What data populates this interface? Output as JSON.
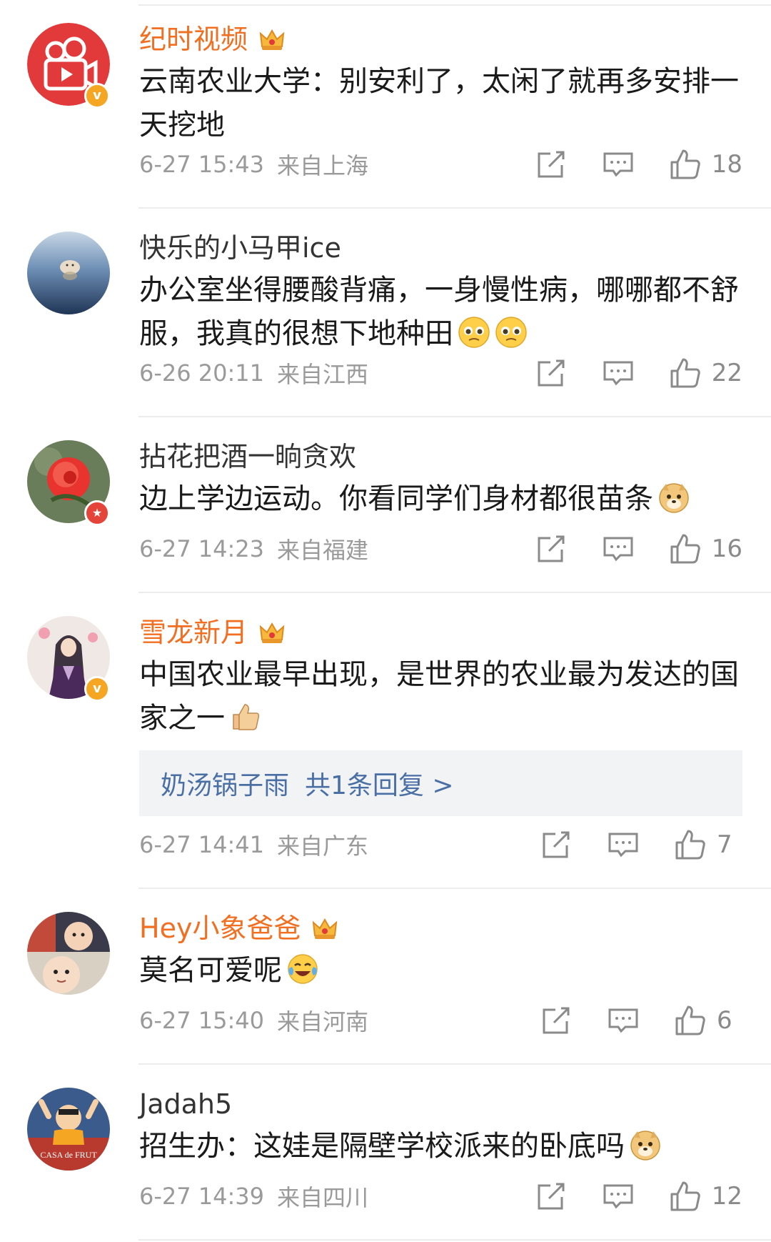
{
  "comments": [
    {
      "username": "纪时视频",
      "vip": true,
      "verified": "v",
      "text": "云南农业大学：别安利了，太闲了就再多安排一天挖地",
      "emojis": [],
      "time": "6-27 15:43",
      "location": "来自上海",
      "likes": "18",
      "avatar": "video-logo"
    },
    {
      "username": "快乐的小马甲ice",
      "vip": false,
      "verified": "",
      "text": "办公室坐得腰酸背痛，一身慢性病，哪哪都不舒服，我真的很想下地种田",
      "emojis": [
        "pleading-emoji",
        "pleading-emoji"
      ],
      "time": "6-26 20:11",
      "location": "来自江西",
      "likes": "22",
      "avatar": "seal-lake-photo"
    },
    {
      "username": "拈花把酒一晌贪欢",
      "vip": false,
      "verified": "star",
      "text": "边上学边运动。你看同学们身材都很苗条",
      "emojis": [
        "doge-emoji"
      ],
      "time": "6-27 14:23",
      "location": "来自福建",
      "likes": "16",
      "avatar": "red-rose-photo"
    },
    {
      "username": "雪龙新月",
      "vip": true,
      "verified": "v",
      "text": "中国农业最早出现，是世界的农业最为发达的国家之一",
      "emojis": [
        "thumbs-up-emoji"
      ],
      "reply": {
        "user": "奶汤锅子雨",
        "summary": "共1条回复 >"
      },
      "time": "6-27 14:41",
      "location": "来自广东",
      "likes": "7",
      "avatar": "anime-character"
    },
    {
      "username": "Hey小象爸爸",
      "vip": true,
      "verified": "",
      "text": "莫名可爱呢",
      "emojis": [
        "laughing-tears-emoji"
      ],
      "time": "6-27 15:40",
      "location": "来自河南",
      "likes": "6",
      "avatar": "child-photo"
    },
    {
      "username": "Jadah5",
      "vip": false,
      "verified": "",
      "text": "招生办：这娃是隔壁学校派来的卧底吗",
      "emojis": [
        "doge-emoji"
      ],
      "time": "6-27 14:39",
      "location": "来自四川",
      "likes": "12",
      "avatar": "cartoon-avatar",
      "avatar_text": "CASA de FRUT"
    }
  ],
  "icons": {
    "repost": "repost-icon",
    "comment": "comment-icon",
    "like": "like-icon"
  },
  "colors": {
    "vip_name": "#f26f21",
    "meta": "#9a9a9a",
    "reply_link": "#4a6fa5"
  }
}
